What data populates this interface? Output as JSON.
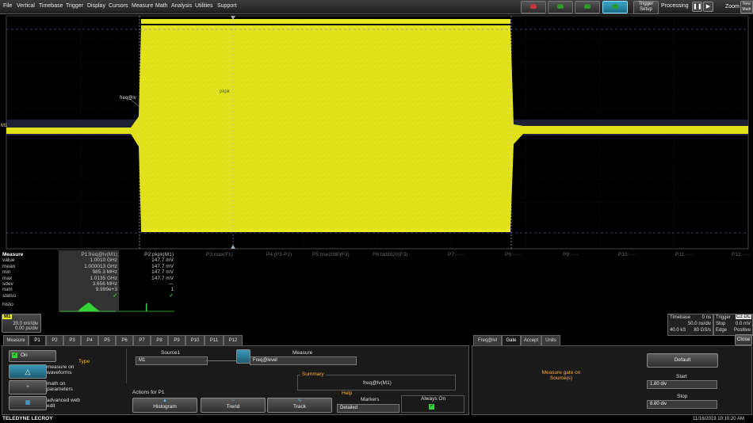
{
  "menu": [
    "File",
    "Vertical",
    "Timebase",
    "Trigger",
    "Display",
    "Cursors",
    "Measure",
    "Math",
    "Analysis",
    "Utilities",
    "Support"
  ],
  "toolbar": {
    "trigger_setup_label": "Trigger Setup",
    "processing_label": "Processing",
    "zoom_label": "Zoom",
    "new_label": "New Math"
  },
  "scope": {
    "annotation_freq": "freq@lv",
    "annotation_pkpk": "pkpk",
    "trace_label": "M1"
  },
  "measure": {
    "rowlabels": [
      "Measure",
      "value",
      "mean",
      "min",
      "max",
      "sdev",
      "num",
      "status"
    ],
    "histo_label": "histo",
    "p1": {
      "header": "P1:freq@lv(M1)",
      "values": [
        "1.0010 GHz",
        "1.000013 GHz",
        "985.3 MHz",
        "1.0135 GHz",
        "3.656 MHz",
        "9.999e+3",
        "✓"
      ]
    },
    "p2": {
      "header": "P2:pkpk(M1)",
      "values": [
        "147.7 mV",
        "147.7 mV",
        "147.7 mV",
        "147.7 mV",
        "---",
        "1",
        "✓"
      ]
    },
    "others": [
      "P3:max(F1)",
      "P4:(P3-P2)",
      "P5:rise2080(F3)",
      "P6:fall8020(F3)",
      "P7:- - -",
      "P8:- - -",
      "P9:- - -",
      "P10:- - -",
      "P11:- - -",
      "P12:- - -"
    ]
  },
  "channel": {
    "tag": "M1",
    "vdiv": "20.0 mV/div",
    "tdiv": "0.00 ps/div"
  },
  "timebase": {
    "label": "Timebase",
    "delay": "0 ns",
    "tdiv": "50.0 ns/div",
    "samples": "40.0 kS",
    "srate": "80 GS/s"
  },
  "trigger": {
    "label": "Trigger",
    "channel": "C2 DC",
    "mode": "Stop",
    "level": "0.0 mV",
    "type": "Edge",
    "slope": "Positive"
  },
  "tabs": [
    "Measure",
    "P1",
    "P2",
    "P3",
    "P4",
    "P5",
    "P6",
    "P7",
    "P8",
    "P9",
    "P10",
    "P11",
    "P12"
  ],
  "tabs_right": [
    "Freq@lvl",
    "Gate",
    "Accept",
    "Units"
  ],
  "close_label": "Close",
  "dialog": {
    "on_label": "On",
    "type_label": "Type",
    "type_options": [
      {
        "label": "measure on waveforms"
      },
      {
        "label": "math on parameters"
      },
      {
        "label": "advanced web edit"
      }
    ],
    "source_label": "Source1",
    "source_value": "M1",
    "measure_label": "Measure",
    "measure_value": "Freq@level",
    "summary_label": "Summary",
    "summary_value": "freq@lv(M1)",
    "actions_label": "Actions for P1",
    "help_label": "Help",
    "action_histogram": "Histogram",
    "action_trend": "Trend",
    "action_track": "Track",
    "markers_label": "Markers",
    "markers_value": "Detailed",
    "always_on_label": "Always On"
  },
  "gate": {
    "title": "Measure gate on Source(s)",
    "default_label": "Default",
    "start_label": "Start",
    "start_value": "1.80 div",
    "stop_label": "Stop",
    "stop_value": "8.80 div"
  },
  "footer": {
    "brand": "TELEDYNE LECROY",
    "datetime": "11/16/2019 10:10:20 AM"
  },
  "colors": {
    "trace": "#e8e820",
    "accent": "#ffae2a",
    "check": "#34d234"
  }
}
